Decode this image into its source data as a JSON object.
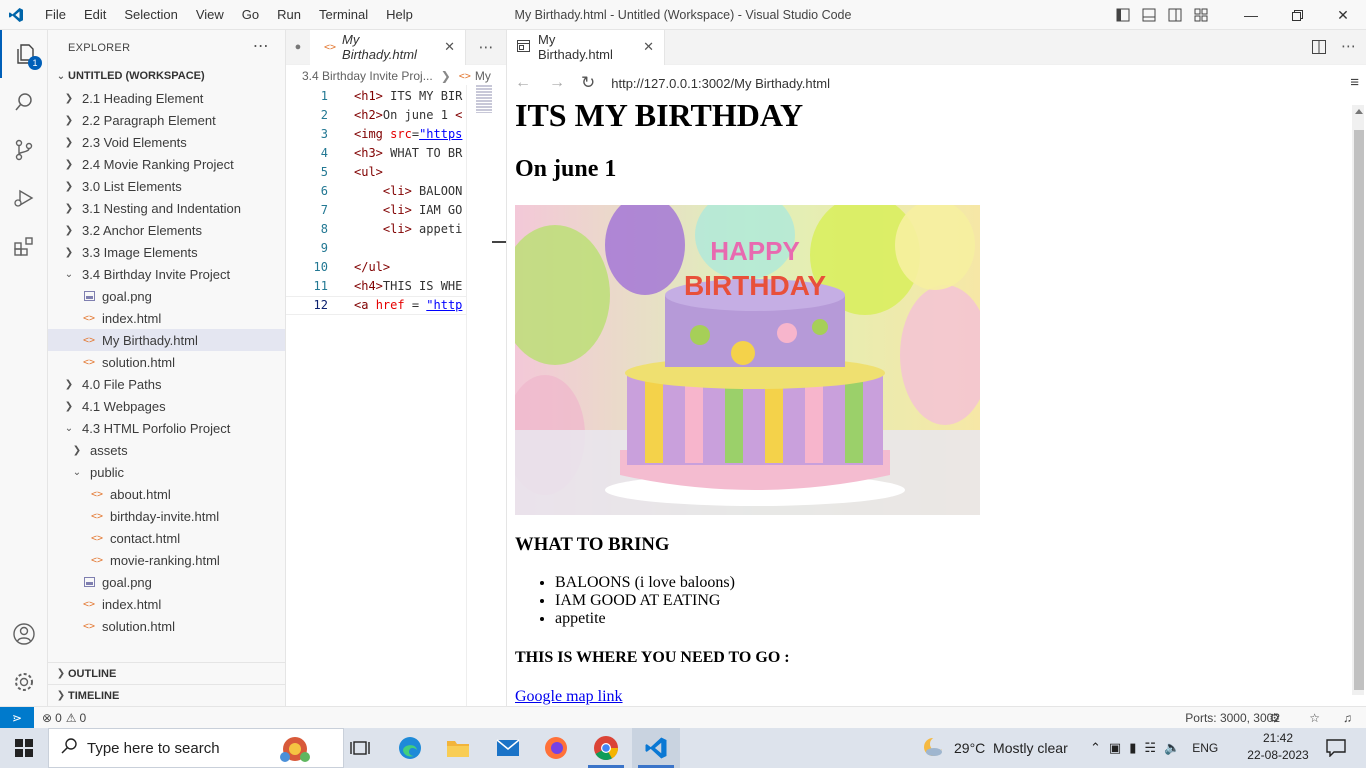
{
  "titlebar": {
    "menu": [
      "File",
      "Edit",
      "Selection",
      "View",
      "Go",
      "Run",
      "Terminal",
      "Help"
    ],
    "window_title": "My Birthady.html - Untitled (Workspace) - Visual Studio Code"
  },
  "activity": {
    "explorer_badge": "1"
  },
  "sidebar": {
    "header": "EXPLORER",
    "workspace": "UNTITLED (WORKSPACE)",
    "items": [
      {
        "label": "2.1 Heading Element",
        "type": "folder",
        "level": 0,
        "open": false
      },
      {
        "label": "2.2 Paragraph Element",
        "type": "folder",
        "level": 0,
        "open": false
      },
      {
        "label": "2.3 Void Elements",
        "type": "folder",
        "level": 0,
        "open": false
      },
      {
        "label": "2.4 Movie Ranking Project",
        "type": "folder",
        "level": 0,
        "open": false
      },
      {
        "label": "3.0 List Elements",
        "type": "folder",
        "level": 0,
        "open": false
      },
      {
        "label": "3.1 Nesting and Indentation",
        "type": "folder",
        "level": 0,
        "open": false
      },
      {
        "label": "3.2 Anchor Elements",
        "type": "folder",
        "level": 0,
        "open": false
      },
      {
        "label": "3.3 Image Elements",
        "type": "folder",
        "level": 0,
        "open": false
      },
      {
        "label": "3.4 Birthday Invite Project",
        "type": "folder",
        "level": 0,
        "open": true
      },
      {
        "label": "goal.png",
        "type": "image",
        "level": 1
      },
      {
        "label": "index.html",
        "type": "html",
        "level": 1
      },
      {
        "label": "My Birthady.html",
        "type": "html",
        "level": 1,
        "selected": true
      },
      {
        "label": "solution.html",
        "type": "html",
        "level": 1
      },
      {
        "label": "4.0 File Paths",
        "type": "folder",
        "level": 0,
        "open": false
      },
      {
        "label": "4.1 Webpages",
        "type": "folder",
        "level": 0,
        "open": false
      },
      {
        "label": "4.3 HTML Porfolio Project",
        "type": "folder",
        "level": 0,
        "open": true
      },
      {
        "label": "assets",
        "type": "folder",
        "level": 1,
        "open": false
      },
      {
        "label": "public",
        "type": "folder",
        "level": 1,
        "open": true
      },
      {
        "label": "about.html",
        "type": "html",
        "level": 2
      },
      {
        "label": "birthday-invite.html",
        "type": "html",
        "level": 2
      },
      {
        "label": "contact.html",
        "type": "html",
        "level": 2
      },
      {
        "label": "movie-ranking.html",
        "type": "html",
        "level": 2
      },
      {
        "label": "goal.png",
        "type": "image",
        "level": 1
      },
      {
        "label": "index.html",
        "type": "html",
        "level": 1
      },
      {
        "label": "solution.html",
        "type": "html",
        "level": 1
      }
    ],
    "outline": "OUTLINE",
    "timeline": "TIMELINE"
  },
  "editor": {
    "tab_label": "My Birthady.html",
    "breadcrumb": [
      "3.4 Birthday Invite Proj...",
      "My"
    ],
    "lines": [
      {
        "n": "1",
        "html": "<span class='tg'>&lt;h1&gt;</span> ITS MY BIR"
      },
      {
        "n": "2",
        "html": "<span class='tg'>&lt;h2&gt;</span>On june 1 <span class='tg'>&lt;</span>"
      },
      {
        "n": "3",
        "html": "<span class='tg'>&lt;img</span> <span class='at'>src</span>=<span class='st'>\"https</span>"
      },
      {
        "n": "4",
        "html": "<span class='tg'>&lt;h3&gt;</span> WHAT TO BR"
      },
      {
        "n": "5",
        "html": "<span class='tg'>&lt;ul&gt;</span>"
      },
      {
        "n": "6",
        "html": "    <span class='tg'>&lt;li&gt;</span> BALOON"
      },
      {
        "n": "7",
        "html": "    <span class='tg'>&lt;li&gt;</span> IAM GO"
      },
      {
        "n": "8",
        "html": "    <span class='tg'>&lt;li&gt;</span> appeti"
      },
      {
        "n": "9",
        "html": ""
      },
      {
        "n": "10",
        "html": "<span class='tg'>&lt;/ul&gt;</span>"
      },
      {
        "n": "11",
        "html": "<span class='tg'>&lt;h4&gt;</span>THIS IS WHE"
      },
      {
        "n": "12",
        "html": "<span class='tg'>&lt;a</span> <span class='at'>href</span> = <span class='st'>\"http</span>"
      }
    ]
  },
  "preview": {
    "tab_label": "My Birthady.html",
    "url": "http://127.0.0.1:3002/My Birthady.html",
    "h1": "ITS MY BIRTHDAY",
    "h2": "On june 1",
    "h3": "WHAT TO BRING",
    "list": [
      "BALOONS (i love baloons)",
      "IAM GOOD AT EATING",
      "appetite"
    ],
    "h4": "THIS IS WHERE YOU NEED TO GO :",
    "link": "Google map link",
    "cake_text_top": "HAPPY",
    "cake_text_bottom": "BIRTHDAY"
  },
  "statusbar": {
    "errors": "0",
    "warnings": "0",
    "ports": "Ports: 3000, 3002"
  },
  "taskbar": {
    "search_placeholder": "Type here to search",
    "weather": "29°C  Mostly clear",
    "lang": "ENG",
    "time": "21:42",
    "date": "22-08-2023"
  }
}
